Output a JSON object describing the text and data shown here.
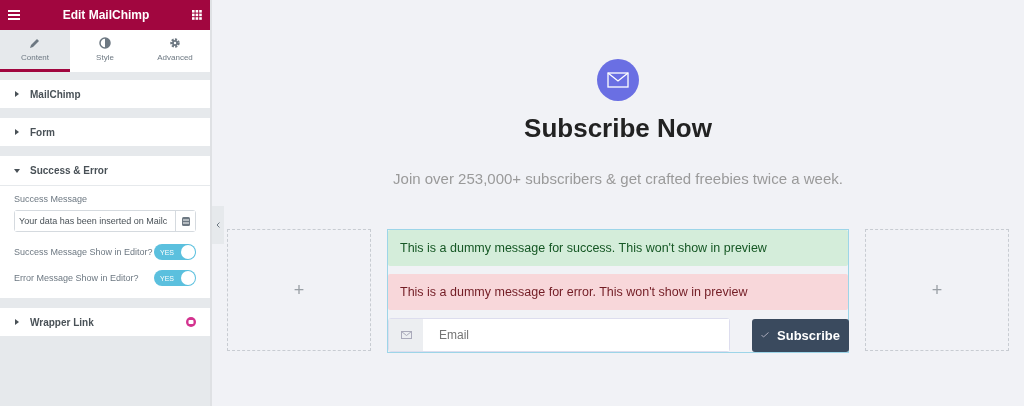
{
  "panel": {
    "title": "Edit MailChimp",
    "tabs": [
      {
        "label": "Content",
        "selected": true
      },
      {
        "label": "Style",
        "selected": false
      },
      {
        "label": "Advanced",
        "selected": false
      }
    ],
    "sections": [
      {
        "title": "MailChimp",
        "expanded": false
      },
      {
        "title": "Form",
        "expanded": false
      },
      {
        "title": "Success & Error",
        "expanded": true,
        "controls": [
          {
            "kind": "text",
            "label": "Success Message",
            "value": "Your data has been inserted on Mailc"
          },
          {
            "kind": "switch",
            "label": "Success Message Show in Editor?",
            "on": true,
            "switch_text": "YES"
          },
          {
            "kind": "switch",
            "label": "Error Message Show in Editor?",
            "on": true,
            "switch_text": "YES"
          }
        ]
      },
      {
        "title": "Wrapper Link",
        "expanded": false,
        "pro": true
      }
    ]
  },
  "preview": {
    "heading": "Subscribe Now",
    "subtitle": "Join over 253,000+ subscribers & get crafted freebies twice a week.",
    "messages": [
      {
        "kind": "success",
        "text": "This is a dummy message for success. This won't show in preview"
      },
      {
        "kind": "error",
        "text": "This is a dummy message for error. This won't show in preview"
      }
    ],
    "email": {
      "placeholder": "Email"
    },
    "button": "Subscribe",
    "add_buttons": [
      "+",
      "+"
    ]
  }
}
